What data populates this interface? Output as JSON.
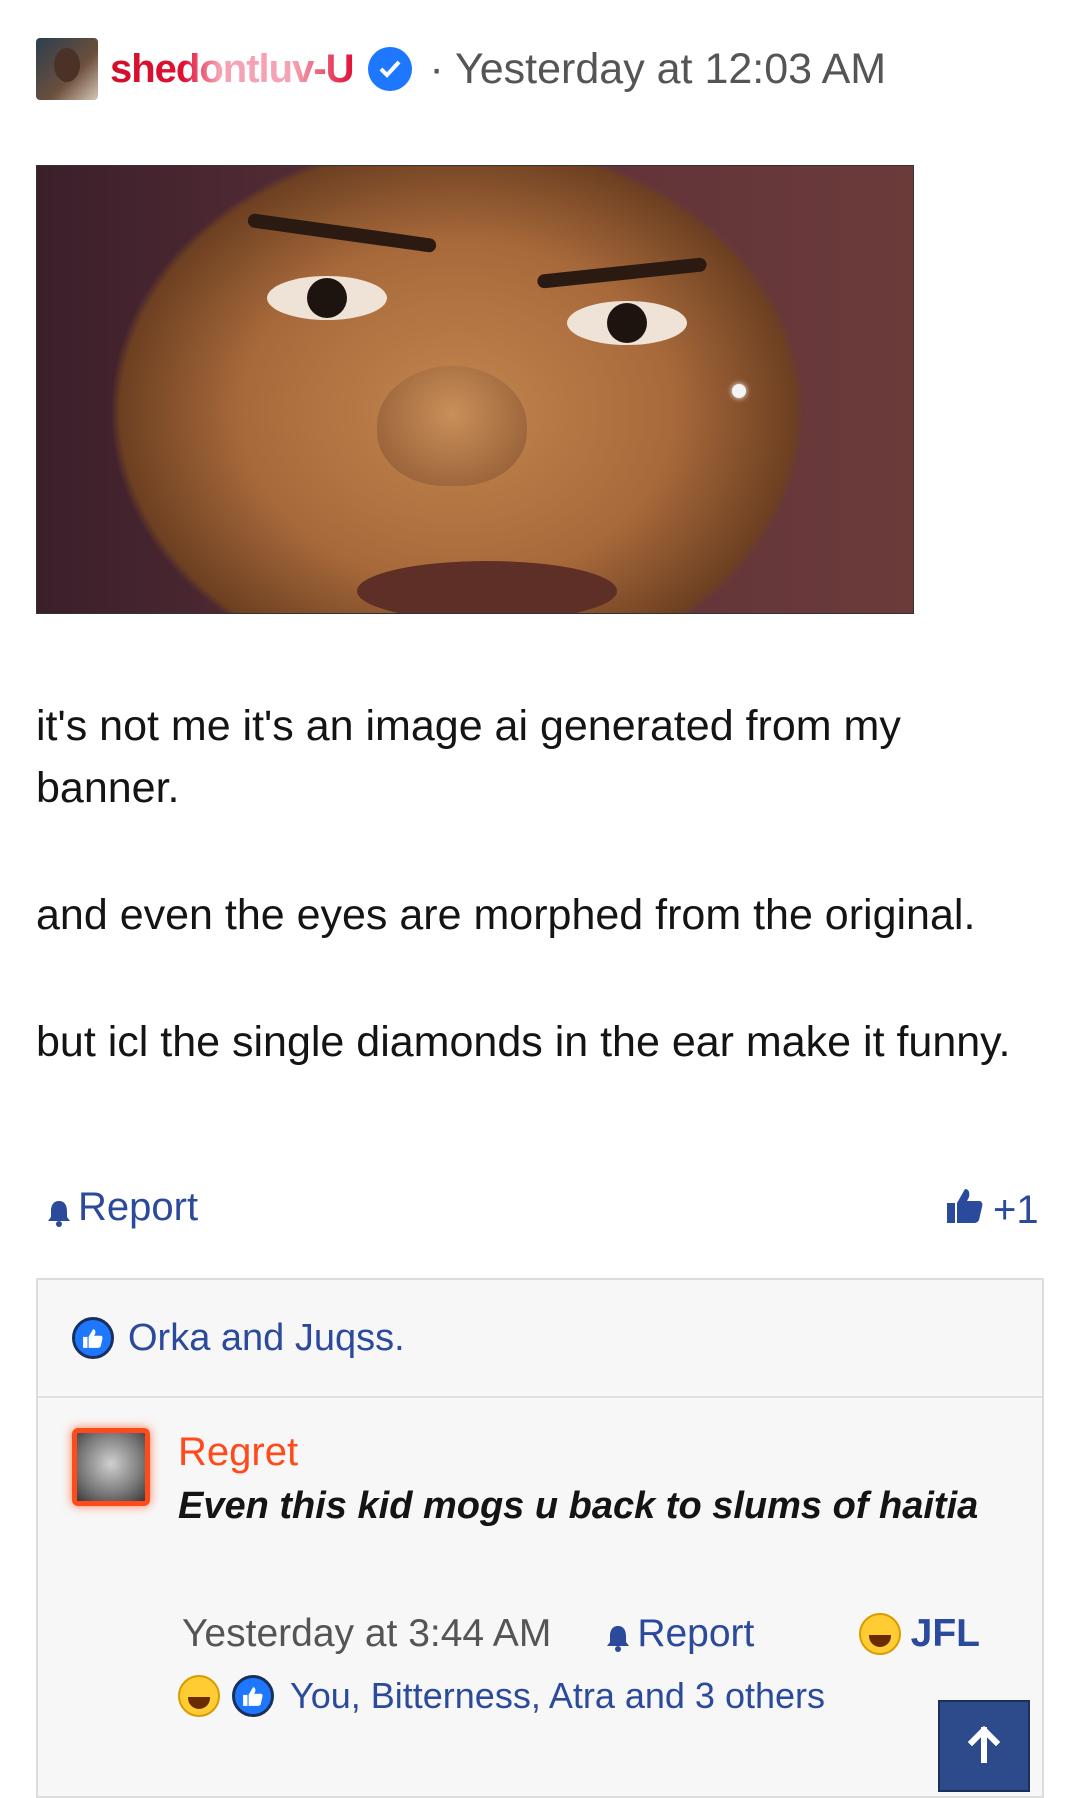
{
  "post": {
    "author": "shedontluv-U",
    "timestamp": "· Yesterday at 12:03 AM",
    "paragraphs": [
      "it's not me it's an image ai generated from my banner.",
      "and even the eyes are morphed from the original.",
      "but icl the single diamonds in the ear make it funny."
    ],
    "report_label": "Report",
    "like_count": "+1",
    "reactions_summary": "Orka and Juqss."
  },
  "comment": {
    "author": "Regret",
    "text": "Even this kid mogs u back to slums of haitia",
    "timestamp": "Yesterday at 3:44 AM",
    "report_label": "Report",
    "reaction_label": "JFL",
    "reactions_summary": "You, Bitterness, Atra and 3 others"
  },
  "icons": {
    "verified": "verified-badge-icon",
    "bell": "bell-icon",
    "thumbs_up": "thumbs-up-icon",
    "laugh": "laughing-emoji-icon",
    "arrow_up": "arrow-up-icon"
  },
  "colors": {
    "link": "#2b4a9b",
    "username_red": "#d0102a",
    "comment_author": "#ff4a1c",
    "verified_blue": "#1d77ff",
    "scroll_button": "#2d4a8a"
  }
}
